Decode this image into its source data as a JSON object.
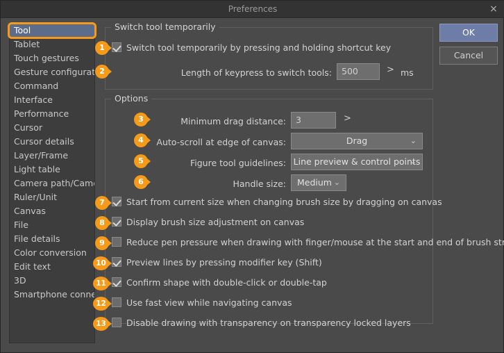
{
  "window": {
    "title": "Preferences",
    "close_icon": "×"
  },
  "buttons": {
    "ok": "OK",
    "cancel": "Cancel"
  },
  "sidebar": {
    "items": [
      {
        "label": "Tool",
        "selected": true
      },
      {
        "label": "Tablet",
        "selected": false
      },
      {
        "label": "Touch gestures",
        "selected": false
      },
      {
        "label": "Gesture configuration",
        "selected": false
      },
      {
        "label": "Command",
        "selected": false
      },
      {
        "label": "Interface",
        "selected": false
      },
      {
        "label": "Performance",
        "selected": false
      },
      {
        "label": "Cursor",
        "selected": false
      },
      {
        "label": "Cursor details",
        "selected": false
      },
      {
        "label": "Layer/Frame",
        "selected": false
      },
      {
        "label": "Light table",
        "selected": false
      },
      {
        "label": "Camera path/Camera",
        "selected": false
      },
      {
        "label": "Ruler/Unit",
        "selected": false
      },
      {
        "label": "Canvas",
        "selected": false
      },
      {
        "label": "File",
        "selected": false
      },
      {
        "label": "File details",
        "selected": false
      },
      {
        "label": "Color conversion",
        "selected": false
      },
      {
        "label": "Edit text",
        "selected": false
      },
      {
        "label": "3D",
        "selected": false
      },
      {
        "label": "Smartphone connection",
        "selected": false
      }
    ]
  },
  "switch_group": {
    "title": "Switch tool temporarily",
    "checkbox_label": "Switch tool temporarily by pressing and holding shortcut key",
    "checkbox_checked": "checked",
    "keypress_label": "Length of keypress to switch tools:",
    "keypress_value": "500",
    "keypress_unit": "ms",
    "stepper_icon": ">"
  },
  "options_group": {
    "title": "Options",
    "min_drag_label": "Minimum drag distance:",
    "min_drag_value": "3",
    "min_drag_stepper": ">",
    "autoscroll_label": "Auto-scroll at edge of canvas:",
    "autoscroll_value": "Drag",
    "guidelines_label": "Figure tool guidelines:",
    "guidelines_value": "Line preview & control points",
    "handle_label": "Handle size:",
    "handle_value": "Medium",
    "dropdown_arrow": "⌄",
    "checks": [
      {
        "label": "Start from current size when changing brush size by dragging on canvas",
        "checked": true
      },
      {
        "label": "Display brush size adjustment on canvas",
        "checked": true
      },
      {
        "label": "Reduce pen pressure when drawing with finger/mouse at the start and end of brush strokes.",
        "checked": false
      },
      {
        "label": "Preview lines by pressing modifier key (Shift)",
        "checked": true
      },
      {
        "label": "Confirm shape with double-click or double-tap",
        "checked": true
      },
      {
        "label": "Use fast view while navigating canvas",
        "checked": false
      },
      {
        "label": "Disable drawing with transparency on transparency locked layers",
        "checked": false
      }
    ]
  },
  "badges": [
    "1",
    "2",
    "3",
    "4",
    "5",
    "6",
    "7",
    "8",
    "9",
    "10",
    "11",
    "12",
    "13"
  ],
  "colors": {
    "accent_orange": "#f59a19",
    "selection_blue": "#5e6c8c",
    "dialog_bg": "#4a4a4a",
    "titlebar_bg": "#333333",
    "ok_button": "#6d7da8"
  }
}
